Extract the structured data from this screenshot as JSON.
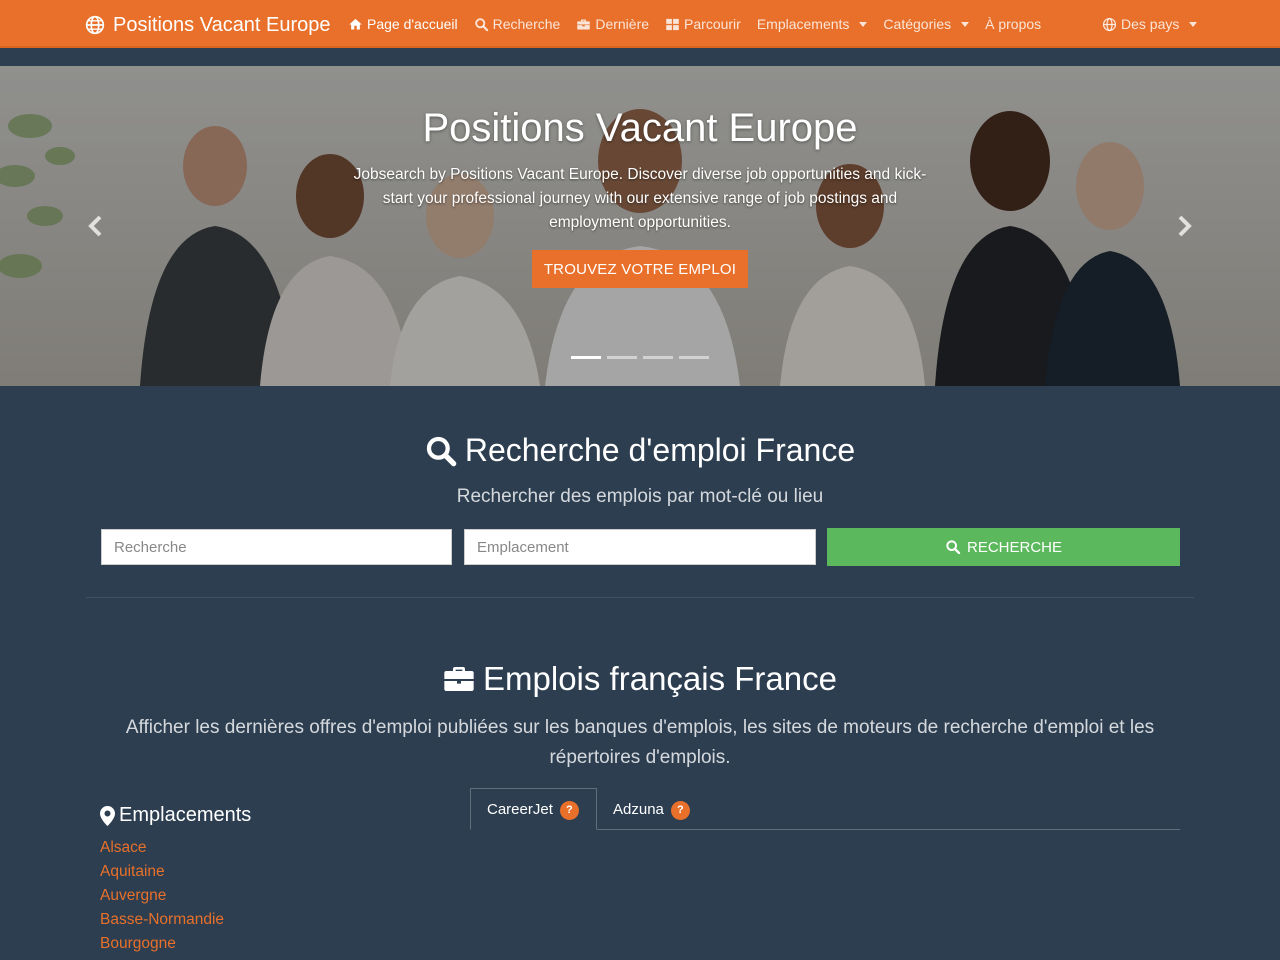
{
  "nav": {
    "brand": "Positions Vacant Europe",
    "items": [
      {
        "label": "Page d'accueil",
        "icon": "home-icon",
        "active": true
      },
      {
        "label": "Recherche",
        "icon": "search-icon"
      },
      {
        "label": "Dernière",
        "icon": "briefcase-icon"
      },
      {
        "label": "Parcourir",
        "icon": "grid-icon"
      },
      {
        "label": "Emplacements",
        "dropdown": true
      },
      {
        "label": "Catégories",
        "dropdown": true
      },
      {
        "label": "À propos"
      }
    ],
    "countries": "Des pays"
  },
  "hero": {
    "title": "Positions Vacant Europe",
    "text": "Jobsearch by Positions Vacant Europe. Discover diverse job opportunities and kick-start your professional journey with our extensive range of job postings and employment opportunities.",
    "button": "TROUVEZ VOTRE EMPLOI",
    "slides": 4,
    "active_slide": 1
  },
  "search": {
    "title": "Recherche d'emploi France",
    "subtitle": "Rechercher des emplois par mot-clé ou lieu",
    "keyword_placeholder": "Recherche",
    "location_placeholder": "Emplacement",
    "button": "RECHERCHE"
  },
  "jobs": {
    "title": "Emplois français France",
    "description": "Afficher les dernières offres d'emploi publiées sur les banques d'emplois, les sites de moteurs de recherche d'emploi et les répertoires d'emplois.",
    "locations_heading": "Emplacements",
    "locations": [
      "Alsace",
      "Aquitaine",
      "Auvergne",
      "Basse-Normandie",
      "Bourgogne"
    ],
    "tabs": [
      {
        "label": "CareerJet",
        "badge": "?",
        "active": true
      },
      {
        "label": "Adzuna",
        "badge": "?"
      }
    ]
  },
  "colors": {
    "primary": "#e8702a",
    "background": "#2c3e50",
    "success": "#5cb85c"
  }
}
